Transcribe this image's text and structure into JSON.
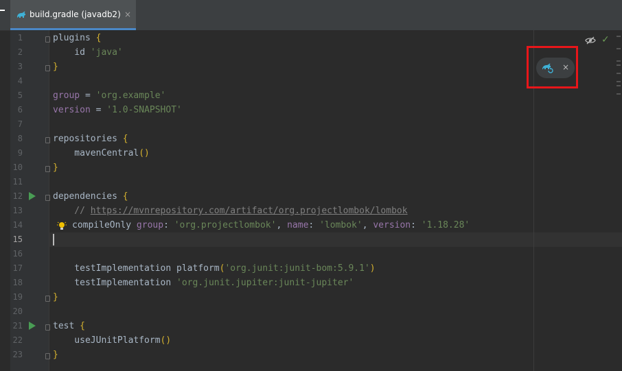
{
  "tab": {
    "title": "build.gradle (javadb2)",
    "close_glyph": "×",
    "icon": "gradle-elephant-icon"
  },
  "editor": {
    "current_line": "15",
    "line_numbers": [
      "1",
      "2",
      "3",
      "4",
      "5",
      "6",
      "7",
      "8",
      "9",
      "10",
      "11",
      "12",
      "13",
      "14",
      "15",
      "16",
      "17",
      "18",
      "19",
      "20",
      "21",
      "22",
      "23"
    ],
    "code": {
      "l1": {
        "t1": "plugins ",
        "t2": "{"
      },
      "l2": {
        "t1": "    id ",
        "t2": "'java'"
      },
      "l3": {
        "t1": "}"
      },
      "l5": {
        "t1": "group",
        "t2": " = ",
        "t3": "'org.example'"
      },
      "l6": {
        "t1": "version",
        "t2": " = ",
        "t3": "'1.0-SNAPSHOT'"
      },
      "l8": {
        "t1": "repositories ",
        "t2": "{"
      },
      "l9": {
        "t1": "    mavenCentral",
        "t2": "()"
      },
      "l10": {
        "t1": "}"
      },
      "l12": {
        "t1": "dependencies ",
        "t2": "{"
      },
      "l13": {
        "t1": "    // ",
        "t2": "https://mvnrepository.com/artifact/org.projectlombok/lombok"
      },
      "l14": {
        "t1": "compileOnly ",
        "t2": "group",
        "t3": ": ",
        "t4": "'org.projectlombok'",
        "t5": ", ",
        "t6": "name",
        "t7": ": ",
        "t8": "'lombok'",
        "t9": ", ",
        "t10": "version",
        "t11": ": ",
        "t12": "'1.18.28'"
      },
      "l17": {
        "t1": "    testImplementation platform",
        "t2": "(",
        "t3": "'org.junit:junit-bom:5.9.1'",
        "t4": ")"
      },
      "l18": {
        "t1": "    testImplementation ",
        "t2": "'org.junit.jupiter:junit-jupiter'"
      },
      "l19": {
        "t1": "}"
      },
      "l21": {
        "t1": "test ",
        "t2": "{"
      },
      "l22": {
        "t1": "    useJUnitPlatform",
        "t2": "()"
      },
      "l23": {
        "t1": "}"
      }
    }
  },
  "right_panel": {
    "check_glyph": "✓",
    "reload_popup": {
      "close_glyph": "×",
      "icon": "gradle-reload-icon"
    }
  },
  "colors": {
    "highlight_border": "#e8161a",
    "keyword": "#cc7832",
    "string": "#6a8759",
    "run_icon": "#499c54",
    "gradle_icon": "#3fb1d6"
  }
}
